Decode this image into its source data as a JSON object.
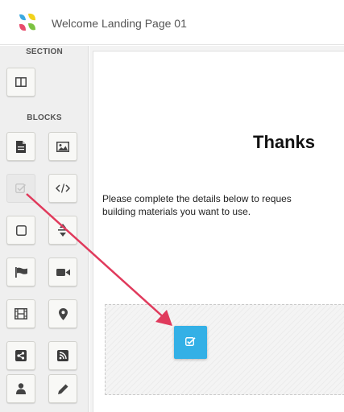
{
  "app": {
    "title": "Welcome Landing Page 01",
    "logo_icon": "multicolor-logo-icon"
  },
  "sidebar": {
    "section_heading": "SECTION",
    "blocks_heading": "BLOCKS",
    "section_items": [
      {
        "name": "columns-layout",
        "icon": "columns-icon"
      }
    ],
    "block_items": [
      {
        "name": "text",
        "icon": "document-icon"
      },
      {
        "name": "image",
        "icon": "image-icon"
      },
      {
        "name": "form",
        "icon": "checkbox-icon",
        "state": "being-dragged"
      },
      {
        "name": "html",
        "icon": "code-icon"
      },
      {
        "name": "button",
        "icon": "square-icon"
      },
      {
        "name": "divider",
        "icon": "divider-icon"
      },
      {
        "name": "banner",
        "icon": "flag-icon"
      },
      {
        "name": "video",
        "icon": "video-camera-icon"
      },
      {
        "name": "film",
        "icon": "film-icon"
      },
      {
        "name": "map",
        "icon": "map-pin-icon"
      },
      {
        "name": "share",
        "icon": "share-icon"
      },
      {
        "name": "rss",
        "icon": "rss-icon"
      },
      {
        "name": "user",
        "icon": "user-icon"
      },
      {
        "name": "edit",
        "icon": "pencil-icon"
      }
    ]
  },
  "canvas": {
    "heading": "Thanks",
    "paragraph_line1": "Please complete the details below to reques",
    "paragraph_line2": "building materials you want to use.",
    "dragged_block_icon": "checkbox-icon"
  },
  "colors": {
    "accent": "#33b0e6",
    "arrow": "#e03a5c",
    "sidebar_bg": "#efefef"
  }
}
